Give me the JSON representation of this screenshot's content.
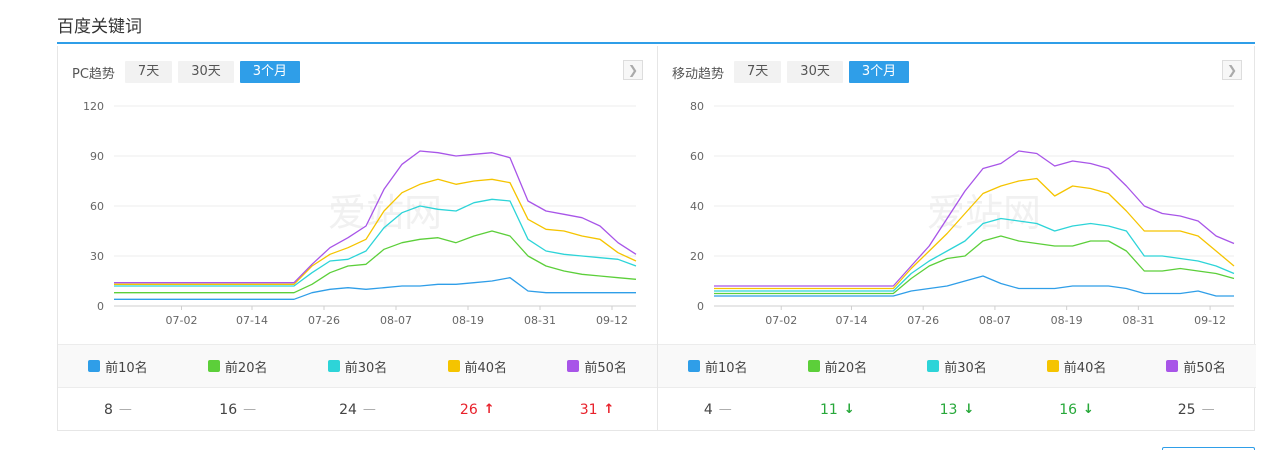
{
  "section_title": "百度关键词",
  "range_buttons": [
    "7天",
    "30天",
    "3个月"
  ],
  "active_range": "3个月",
  "series_names": [
    "前10名",
    "前20名",
    "前30名",
    "前40名",
    "前50名"
  ],
  "series_colors": [
    "#2f9ee8",
    "#5ccf3a",
    "#2dd4d8",
    "#f5c400",
    "#a855e8"
  ],
  "watermark": "爱站网",
  "chart_data": [
    {
      "type": "line",
      "panel_label": "PC趋势",
      "x": [
        "06-21",
        "06-24",
        "06-27",
        "06-30",
        "07-03",
        "07-06",
        "07-09",
        "07-12",
        "07-15",
        "07-18",
        "07-21",
        "07-24",
        "07-27",
        "07-30",
        "08-02",
        "08-05",
        "08-08",
        "08-11",
        "08-14",
        "08-17",
        "08-20",
        "08-23",
        "08-26",
        "08-29",
        "09-01",
        "09-04",
        "09-07",
        "09-10",
        "09-13",
        "09-16"
      ],
      "x_tick_labels": [
        "07-02",
        "07-14",
        "07-26",
        "08-07",
        "08-19",
        "08-31",
        "09-12"
      ],
      "y_ticks": [
        0,
        30,
        60,
        90,
        120
      ],
      "ylim": [
        0,
        120
      ],
      "series": [
        {
          "name": "前10名",
          "values": [
            4,
            4,
            4,
            4,
            4,
            4,
            4,
            4,
            4,
            4,
            4,
            8,
            10,
            11,
            10,
            11,
            12,
            12,
            13,
            13,
            14,
            15,
            17,
            9,
            8,
            8,
            8,
            8,
            8,
            8
          ]
        },
        {
          "name": "前20名",
          "values": [
            8,
            8,
            8,
            8,
            8,
            8,
            8,
            8,
            8,
            8,
            8,
            13,
            20,
            24,
            25,
            34,
            38,
            40,
            41,
            38,
            42,
            45,
            42,
            30,
            24,
            21,
            19,
            18,
            17,
            16
          ]
        },
        {
          "name": "前30名",
          "values": [
            12,
            12,
            12,
            12,
            12,
            12,
            12,
            12,
            12,
            12,
            12,
            20,
            27,
            28,
            33,
            47,
            56,
            60,
            58,
            57,
            62,
            64,
            63,
            40,
            33,
            31,
            30,
            29,
            28,
            24
          ]
        },
        {
          "name": "前40名",
          "values": [
            13,
            13,
            13,
            13,
            13,
            13,
            13,
            13,
            13,
            13,
            13,
            24,
            31,
            35,
            40,
            57,
            68,
            73,
            76,
            73,
            75,
            76,
            74,
            52,
            46,
            45,
            42,
            40,
            32,
            27
          ]
        },
        {
          "name": "前50名",
          "values": [
            14,
            14,
            14,
            14,
            14,
            14,
            14,
            14,
            14,
            14,
            14,
            25,
            35,
            41,
            48,
            70,
            85,
            93,
            92,
            90,
            91,
            92,
            89,
            63,
            57,
            55,
            53,
            48,
            38,
            31
          ]
        }
      ],
      "current": [
        {
          "value": "8",
          "trend": "flat"
        },
        {
          "value": "16",
          "trend": "flat"
        },
        {
          "value": "24",
          "trend": "flat"
        },
        {
          "value": "26",
          "trend": "up"
        },
        {
          "value": "31",
          "trend": "up"
        }
      ]
    },
    {
      "type": "line",
      "panel_label": "移动趋势",
      "x": [
        "06-21",
        "06-24",
        "06-27",
        "06-30",
        "07-03",
        "07-06",
        "07-09",
        "07-12",
        "07-15",
        "07-18",
        "07-21",
        "07-24",
        "07-27",
        "07-30",
        "08-02",
        "08-05",
        "08-08",
        "08-11",
        "08-14",
        "08-17",
        "08-20",
        "08-23",
        "08-26",
        "08-29",
        "09-01",
        "09-04",
        "09-07",
        "09-10",
        "09-13",
        "09-16"
      ],
      "x_tick_labels": [
        "07-02",
        "07-14",
        "07-26",
        "08-07",
        "08-19",
        "08-31",
        "09-12"
      ],
      "y_ticks": [
        0,
        20,
        40,
        60,
        80
      ],
      "ylim": [
        0,
        80
      ],
      "series": [
        {
          "name": "前10名",
          "values": [
            4,
            4,
            4,
            4,
            4,
            4,
            4,
            4,
            4,
            4,
            4,
            6,
            7,
            8,
            10,
            12,
            9,
            7,
            7,
            7,
            8,
            8,
            8,
            7,
            5,
            5,
            5,
            6,
            4,
            4
          ]
        },
        {
          "name": "前20名",
          "values": [
            5,
            5,
            5,
            5,
            5,
            5,
            5,
            5,
            5,
            5,
            5,
            11,
            16,
            19,
            20,
            26,
            28,
            26,
            25,
            24,
            24,
            26,
            26,
            22,
            14,
            14,
            15,
            14,
            13,
            11
          ]
        },
        {
          "name": "前30名",
          "values": [
            6,
            6,
            6,
            6,
            6,
            6,
            6,
            6,
            6,
            6,
            6,
            13,
            18,
            22,
            26,
            33,
            35,
            34,
            33,
            30,
            32,
            33,
            32,
            30,
            20,
            20,
            19,
            18,
            16,
            13
          ]
        },
        {
          "name": "前40名",
          "values": [
            7,
            7,
            7,
            7,
            7,
            7,
            7,
            7,
            7,
            7,
            7,
            15,
            22,
            29,
            37,
            45,
            48,
            50,
            51,
            44,
            48,
            47,
            45,
            38,
            30,
            30,
            30,
            28,
            22,
            16
          ]
        },
        {
          "name": "前50名",
          "values": [
            8,
            8,
            8,
            8,
            8,
            8,
            8,
            8,
            8,
            8,
            8,
            16,
            24,
            35,
            46,
            55,
            57,
            62,
            61,
            56,
            58,
            57,
            55,
            48,
            40,
            37,
            36,
            34,
            28,
            25
          ]
        }
      ],
      "current": [
        {
          "value": "4",
          "trend": "flat"
        },
        {
          "value": "11",
          "trend": "down"
        },
        {
          "value": "13",
          "trend": "down"
        },
        {
          "value": "16",
          "trend": "down"
        },
        {
          "value": "25",
          "trend": "flat"
        }
      ]
    }
  ]
}
